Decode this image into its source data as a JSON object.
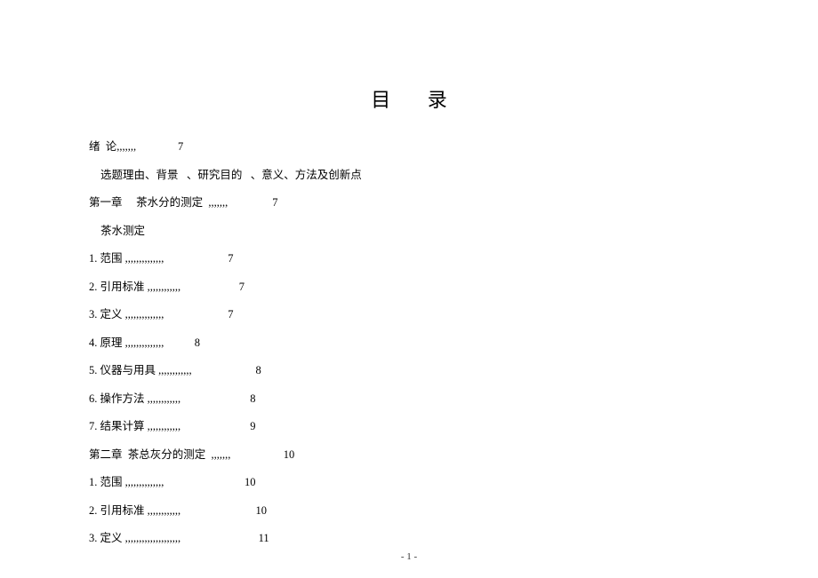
{
  "title": "目 录",
  "toc": {
    "line1_text": "绪  论,,,,,,,",
    "line1_page": "               7",
    "line2_text": "选题理由、背景   、研究目的   、意义、方法及创新点",
    "line3_text": "第一章     茶水分的测定  ,,,,,,,",
    "line3_page": "                7",
    "line4_text": "茶水测定",
    "line5_text": "1. 范围 ,,,,,,,,,,,,,,",
    "line5_page": "                       7",
    "line6_text": "2. 引用标准 ,,,,,,,,,,,,",
    "line6_page": "                     7",
    "line7_text": "3. 定义 ,,,,,,,,,,,,,,",
    "line7_page": "                       7",
    "line8_text": "4. 原理 ,,,,,,,,,,,,,,",
    "line8_page": "           8",
    "line9_text": "5. 仪器与用具 ,,,,,,,,,,,,",
    "line9_page": "                       8",
    "line10_text": "6. 操作方法 ,,,,,,,,,,,,",
    "line10_page": "                         8",
    "line11_text": "7. 结果计算 ,,,,,,,,,,,,",
    "line11_page": "                         9",
    "line12_text": "第二章  茶总灰分的测定  ,,,,,,,",
    "line12_page": "                   10",
    "line13_text": "1. 范围 ,,,,,,,,,,,,,,",
    "line13_page": "                             10",
    "line14_text": "2. 引用标准 ,,,,,,,,,,,,",
    "line14_page": "                           10",
    "line15_text": "3. 定义 ,,,,,,,,,,,,,,,,,,,,",
    "line15_page": "                            11"
  },
  "footer": "- 1 -"
}
